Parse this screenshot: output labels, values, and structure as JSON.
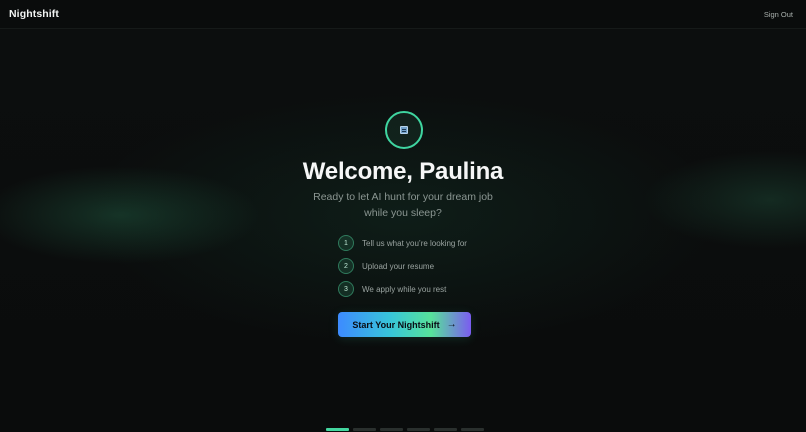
{
  "app": {
    "brand": "Nightshift"
  },
  "header": {
    "sign_out": "Sign Out"
  },
  "hero": {
    "icon": "moon-icon",
    "title": "Welcome, Paulina",
    "subtitle_line1": "Ready to let AI hunt for your dream job",
    "subtitle_line2": "while you sleep?"
  },
  "steps": [
    {
      "number": "1",
      "label": "Tell us what you’re looking for"
    },
    {
      "number": "2",
      "label": "Upload your resume"
    },
    {
      "number": "3",
      "label": "We apply while you rest"
    }
  ],
  "cta": {
    "label": "Start Your Nightshift",
    "icon": "arrow-right-icon"
  },
  "pager": {
    "total": 6,
    "active_index": 0
  },
  "colors": {
    "accent": "#43d69f",
    "background": "#0b0d0d",
    "cta_gradient_start": "#3d8bff",
    "cta_gradient_end": "#7b5cf0"
  }
}
